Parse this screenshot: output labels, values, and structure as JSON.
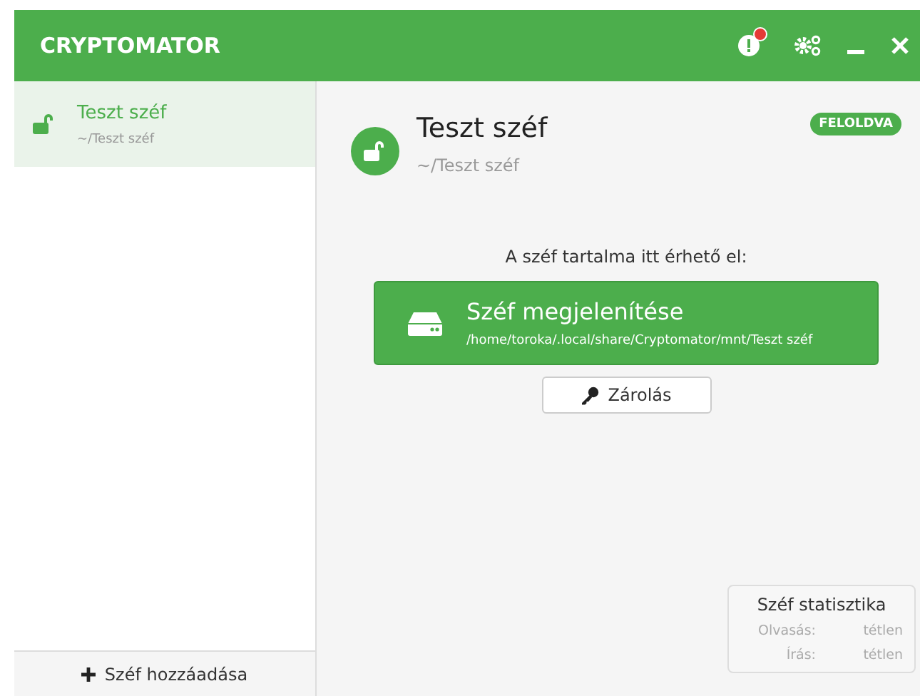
{
  "window": {
    "title": "CRYPTOMATOR",
    "has_update_notice": true
  },
  "sidebar": {
    "items": [
      {
        "name": "Teszt széf",
        "path": "~/Teszt széf",
        "unlocked": true,
        "selected": true
      }
    ],
    "add_button": "Széf hozzáadása"
  },
  "detail": {
    "name": "Teszt széf",
    "path": "~/Teszt széf",
    "unlocked": true,
    "status": "FELOLDVA",
    "access_label": "A széf tartalma itt érhető el:",
    "reveal_button": {
      "label": "Széf megjelenítése",
      "path": "/home/toroka/.local/share/Cryptomator/mnt/Teszt széf"
    },
    "lock_button": "Zárolás",
    "stats": {
      "title": "Széf statisztika",
      "rows": [
        {
          "label": "Olvasás:",
          "value": "tétlen"
        },
        {
          "label": "Írás:",
          "value": "tétlen"
        }
      ]
    }
  }
}
